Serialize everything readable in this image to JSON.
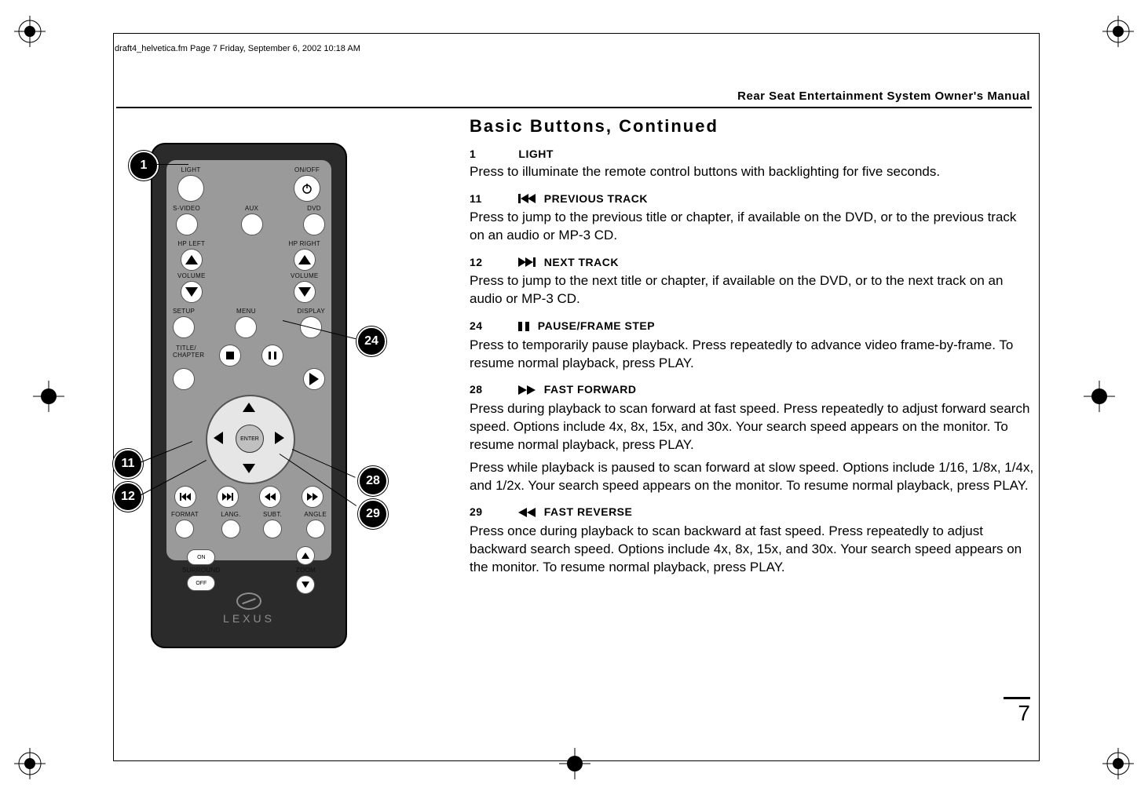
{
  "print": {
    "header": "draft4_helvetica.fm  Page 7  Friday, September 6, 2002  10:18 AM"
  },
  "running_head": "Rear Seat Entertainment System Owner's Manual",
  "page_number": "7",
  "heading": "Basic Buttons, Continued",
  "sections": [
    {
      "num": "1",
      "title": "LIGHT",
      "body1": "Press to illuminate the remote control buttons with backlighting for five seconds."
    },
    {
      "num": "11",
      "title": "PREVIOUS TRACK",
      "body1": "Press to jump to the previous title or chapter, if available on the DVD, or to the previous track on an audio or MP-3 CD."
    },
    {
      "num": "12",
      "title": "NEXT TRACK",
      "body1": "Press to jump to the next title or chapter, if available on the DVD, or to the next track on an audio or MP-3 CD."
    },
    {
      "num": "24",
      "title": "PAUSE/FRAME STEP",
      "body1": "Press to temporarily pause playback. Press repeatedly to advance video frame-by-frame. To resume normal playback, press     PLAY."
    },
    {
      "num": "28",
      "title": "FAST FORWARD",
      "body1": "Press during playback to scan forward at fast speed. Press repeatedly to adjust forward search speed. Options include 4x, 8x, 15x, and 30x. Your search speed appears on the monitor. To resume normal playback, press    PLAY.",
      "body2": "Press while playback is paused to scan forward at slow speed. Options include 1/16, 1/8x, 1/4x, and 1/2x. Your search speed appears on the monitor. To resume normal playback, press    PLAY."
    },
    {
      "num": "29",
      "title": "FAST REVERSE",
      "body1": "Press once during playback to scan backward at fast speed. Press repeatedly to adjust backward search speed. Options include 4x, 8x, 15x, and 30x. Your search speed appears on the monitor. To resume normal playback, press    PLAY."
    }
  ],
  "remote_labels": {
    "light": "LIGHT",
    "onoff": "ON/OFF",
    "svideo": "S-VIDEO",
    "aux": "AUX",
    "dvd": "DVD",
    "hpleft": "HP LEFT",
    "hpright": "HP RIGHT",
    "volume": "VOLUME",
    "setup": "SETUP",
    "menu": "MENU",
    "display": "DISPLAY",
    "title": "TITLE/\nCHAPTER",
    "enter": "ENTER",
    "format": "FORMAT",
    "lang": "LANG.",
    "subt": "SUBT.",
    "angle": "ANGLE",
    "surround": "SURROUND",
    "zoom": "ZOOM",
    "on": "ON",
    "off": "OFF",
    "brand": "LEXUS"
  },
  "callouts": {
    "c1": "1",
    "c11": "11",
    "c12": "12",
    "c24": "24",
    "c28": "28",
    "c29": "29"
  }
}
